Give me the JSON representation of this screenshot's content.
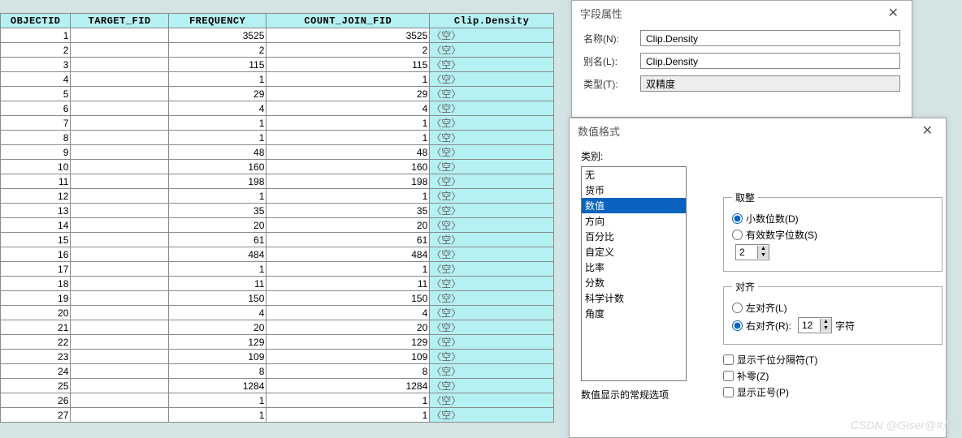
{
  "table": {
    "headers": [
      "OBJECTID",
      "TARGET_FID",
      "FREQUENCY",
      "COUNT_JOIN_FID",
      "Clip.Density"
    ],
    "null_text": "〈空〉",
    "rows": [
      {
        "oid": "1",
        "tf": "",
        "freq": "3525",
        "cj": "3525"
      },
      {
        "oid": "2",
        "tf": "",
        "freq": "2",
        "cj": "2"
      },
      {
        "oid": "3",
        "tf": "",
        "freq": "115",
        "cj": "115"
      },
      {
        "oid": "4",
        "tf": "",
        "freq": "1",
        "cj": "1"
      },
      {
        "oid": "5",
        "tf": "",
        "freq": "29",
        "cj": "29"
      },
      {
        "oid": "6",
        "tf": "",
        "freq": "4",
        "cj": "4"
      },
      {
        "oid": "7",
        "tf": "",
        "freq": "1",
        "cj": "1"
      },
      {
        "oid": "8",
        "tf": "",
        "freq": "1",
        "cj": "1"
      },
      {
        "oid": "9",
        "tf": "",
        "freq": "48",
        "cj": "48"
      },
      {
        "oid": "10",
        "tf": "",
        "freq": "160",
        "cj": "160"
      },
      {
        "oid": "11",
        "tf": "",
        "freq": "198",
        "cj": "198"
      },
      {
        "oid": "12",
        "tf": "",
        "freq": "1",
        "cj": "1"
      },
      {
        "oid": "13",
        "tf": "",
        "freq": "35",
        "cj": "35"
      },
      {
        "oid": "14",
        "tf": "",
        "freq": "20",
        "cj": "20"
      },
      {
        "oid": "15",
        "tf": "",
        "freq": "61",
        "cj": "61"
      },
      {
        "oid": "16",
        "tf": "",
        "freq": "484",
        "cj": "484"
      },
      {
        "oid": "17",
        "tf": "",
        "freq": "1",
        "cj": "1"
      },
      {
        "oid": "18",
        "tf": "",
        "freq": "11",
        "cj": "11"
      },
      {
        "oid": "19",
        "tf": "",
        "freq": "150",
        "cj": "150"
      },
      {
        "oid": "20",
        "tf": "",
        "freq": "4",
        "cj": "4"
      },
      {
        "oid": "21",
        "tf": "",
        "freq": "20",
        "cj": "20"
      },
      {
        "oid": "22",
        "tf": "",
        "freq": "129",
        "cj": "129"
      },
      {
        "oid": "23",
        "tf": "",
        "freq": "109",
        "cj": "109"
      },
      {
        "oid": "24",
        "tf": "",
        "freq": "8",
        "cj": "8"
      },
      {
        "oid": "25",
        "tf": "",
        "freq": "1284",
        "cj": "1284"
      },
      {
        "oid": "26",
        "tf": "",
        "freq": "1",
        "cj": "1"
      },
      {
        "oid": "27",
        "tf": "",
        "freq": "1",
        "cj": "1"
      }
    ]
  },
  "field_props": {
    "title": "字段属性",
    "name_label": "名称(N):",
    "name_value": "Clip.Density",
    "alias_label": "别名(L):",
    "alias_value": "Clip.Density",
    "type_label": "类型(T):",
    "type_value": "双精度"
  },
  "num_format": {
    "title": "数值格式",
    "category_label": "类别:",
    "categories": [
      "无",
      "货币",
      "数值",
      "方向",
      "百分比",
      "自定义",
      "比率",
      "分数",
      "科学计数",
      "角度"
    ],
    "selected_index": 2,
    "rounding": {
      "legend": "取整",
      "decimal_places": "小数位数(D)",
      "significant": "有效数字位数(S)",
      "value": "2"
    },
    "align": {
      "legend": "对齐",
      "left": "左对齐(L)",
      "right": "右对齐(R):",
      "value": "12",
      "chars": "字符"
    },
    "checks": {
      "thousands": "显示千位分隔符(T)",
      "pad": "补零(Z)",
      "plus": "显示正号(P)"
    },
    "footer": "数值显示的常规选项"
  },
  "watermark": "CSDN @Giser@#序"
}
